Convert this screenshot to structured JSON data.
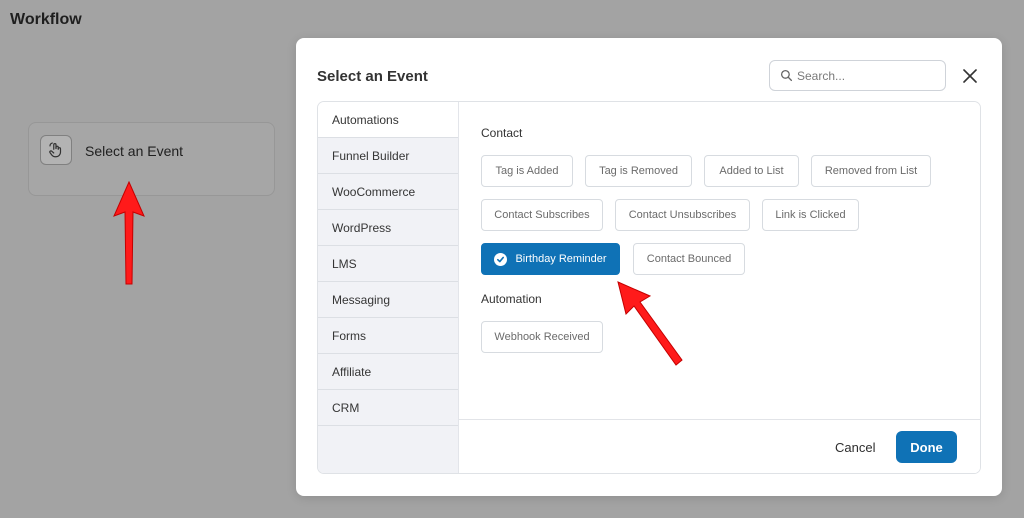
{
  "page": {
    "title": "Workflow"
  },
  "node": {
    "label": "Select an Event",
    "icon": "hand-pointer-icon"
  },
  "modal": {
    "title": "Select an Event",
    "search": {
      "placeholder": "Search...",
      "value": ""
    },
    "sidebar": {
      "items": [
        {
          "label": "Automations",
          "active": true
        },
        {
          "label": "Funnel Builder",
          "active": false
        },
        {
          "label": "WooCommerce",
          "active": false
        },
        {
          "label": "WordPress",
          "active": false
        },
        {
          "label": "LMS",
          "active": false
        },
        {
          "label": "Messaging",
          "active": false
        },
        {
          "label": "Forms",
          "active": false
        },
        {
          "label": "Affiliate",
          "active": false
        },
        {
          "label": "CRM",
          "active": false
        }
      ]
    },
    "sections": {
      "contact": {
        "label": "Contact",
        "events": [
          {
            "label": "Tag is Added",
            "selected": false
          },
          {
            "label": "Tag is Removed",
            "selected": false
          },
          {
            "label": "Added to List",
            "selected": false
          },
          {
            "label": "Removed from List",
            "selected": false
          },
          {
            "label": "Contact Subscribes",
            "selected": false
          },
          {
            "label": "Contact Unsubscribes",
            "selected": false
          },
          {
            "label": "Link is Clicked",
            "selected": false
          },
          {
            "label": "Birthday Reminder",
            "selected": true
          },
          {
            "label": "Contact Bounced",
            "selected": false
          }
        ]
      },
      "automation": {
        "label": "Automation",
        "events": [
          {
            "label": "Webhook Received",
            "selected": false
          }
        ]
      }
    },
    "footer": {
      "cancel_label": "Cancel",
      "done_label": "Done"
    }
  },
  "colors": {
    "accent": "#0f72b6",
    "overlay": "#a3a3a3",
    "annotation_arrow": "#ff1a1a"
  }
}
